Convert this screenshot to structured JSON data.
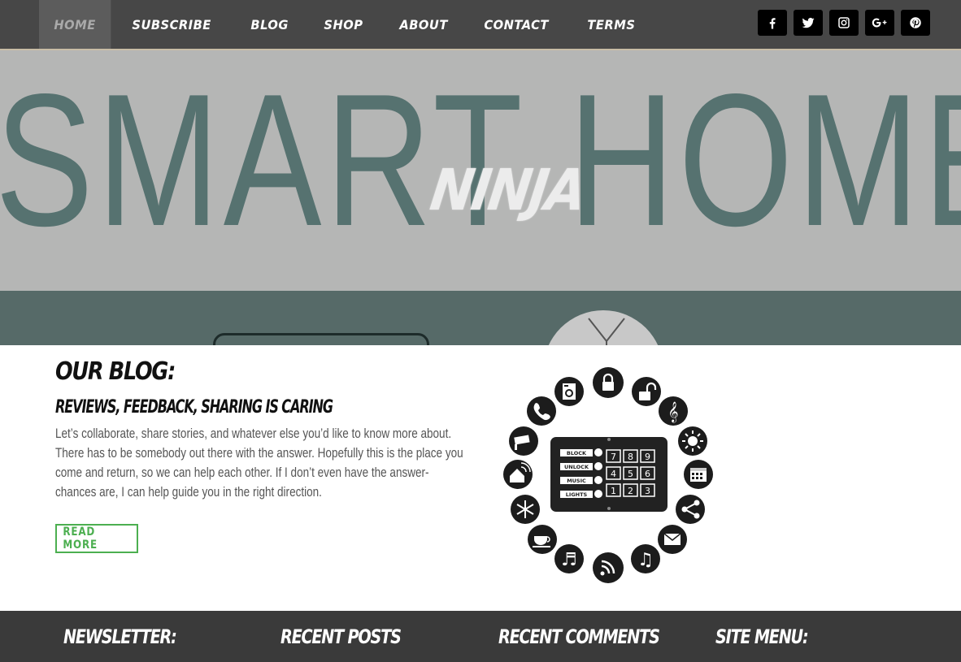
{
  "nav": {
    "items": [
      {
        "label": "HOME",
        "active": true
      },
      {
        "label": "SUBSCRIBE"
      },
      {
        "label": "BLOG"
      },
      {
        "label": "SHOP"
      },
      {
        "label": "ABOUT"
      },
      {
        "label": "CONTACT"
      },
      {
        "label": "TERMS"
      }
    ],
    "socials": [
      "facebook-icon",
      "twitter-icon",
      "instagram-icon",
      "google-plus-icon",
      "pinterest-icon"
    ]
  },
  "hero": {
    "background_text": "SMART HOME",
    "logo_text": "NINJA"
  },
  "blog": {
    "title": "OUR BLOG:",
    "subtitle": "REVIEWS, FEEDBACK, SHARING IS CARING",
    "body": "Let’s collaborate, share stories, and whatever else you’d like to know more about.  There has to be somebody out there with the answer.  Hopefully this is the place you come and return, so we can help each other.  If I don’t even have the answer- chances are, I can help guide you in the right direction.",
    "read_more": "READ MORE"
  },
  "wheel": {
    "panel_labels": [
      "BLOCK",
      "UNLOCK",
      "MUSIC",
      "LIGHTS"
    ],
    "keypad": [
      "7",
      "8",
      "9",
      "4",
      "5",
      "6",
      "1",
      "2",
      "3"
    ],
    "icons": [
      "lock-icon",
      "unlock-icon",
      "treble-clef-icon",
      "sun-icon",
      "calendar-icon",
      "share-icon",
      "mail-icon",
      "music-notes-icon",
      "wifi-signal-icon",
      "music-note-icon",
      "coffee-icon",
      "snowflake-icon",
      "home-wifi-icon",
      "camera-icon",
      "phone-icon",
      "washer-icon"
    ]
  },
  "footer": {
    "headings": [
      "NEWSLETTER:",
      "RECENT POSTS",
      "RECENT COMMENTS",
      "SITE MENU:"
    ]
  },
  "colors": {
    "nav_bg": "#474747",
    "hero_text": "#567270",
    "accent_green": "#4caf50",
    "footer_bg": "#3a3a3a"
  }
}
